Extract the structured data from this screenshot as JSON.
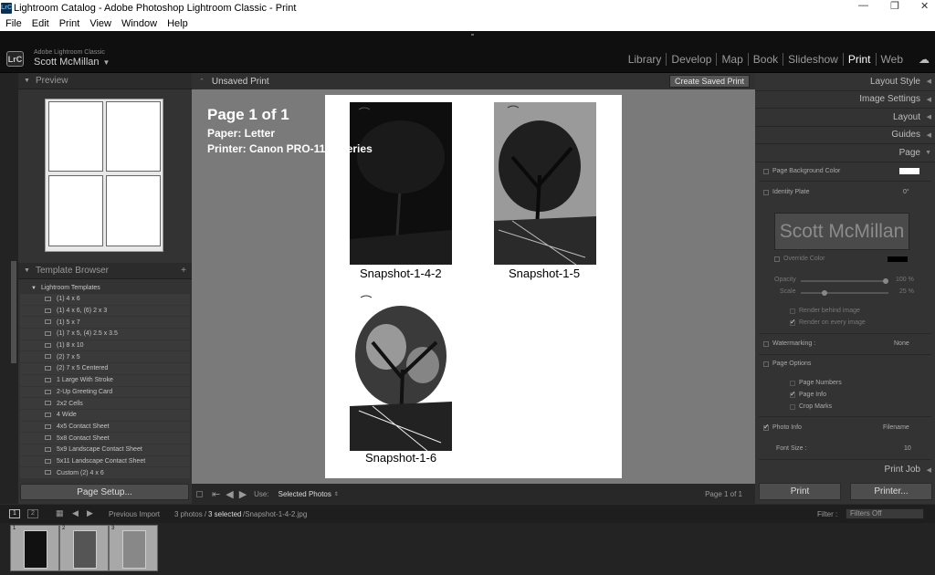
{
  "window": {
    "title": "Lightroom Catalog - Adobe Photoshop Lightroom Classic - Print",
    "app_badge": "LrC"
  },
  "menu": [
    "File",
    "Edit",
    "Print",
    "View",
    "Window",
    "Help"
  ],
  "identity": {
    "product": "Adobe Lightroom Classic",
    "user": "Scott McMillan"
  },
  "modules": [
    {
      "label": "Library"
    },
    {
      "label": "Develop"
    },
    {
      "label": "Map"
    },
    {
      "label": "Book"
    },
    {
      "label": "Slideshow"
    },
    {
      "label": "Print"
    },
    {
      "label": "Web"
    }
  ],
  "active_module": "Print",
  "left": {
    "preview_label": "Preview",
    "template_browser_label": "Template Browser",
    "template_folder": "Lightroom Templates",
    "templates": [
      "(1) 4 x 6",
      "(1) 4 x 6, (6) 2 x 3",
      "(1) 5 x 7",
      "(1) 7 x 5, (4) 2.5 x 3.5",
      "(1) 8 x 10",
      "(2) 7 x 5",
      "(2) 7 x 5 Centered",
      "1 Large With Stroke",
      "2-Up Greeting Card",
      "2x2 Cells",
      "4 Wide",
      "4x5 Contact Sheet",
      "5x8 Contact Sheet",
      "5x9 Landscape Contact Sheet",
      "5x11 Landscape Contact Sheet",
      "Custom (2) 4 x 6"
    ],
    "page_setup_label": "Page Setup..."
  },
  "center": {
    "doc_title": "Unsaved Print",
    "save_button": "Create Saved Print",
    "page_info": {
      "page": "Page 1 of 1",
      "paper": "Paper:  Letter",
      "printer": "Printer:  Canon PRO-1100 series"
    },
    "captions": [
      "Snapshot-1-4-2",
      "Snapshot-1-5",
      "Snapshot-1-6"
    ],
    "toolbar": {
      "use_label": "Use:",
      "use_value": "Selected Photos",
      "page_count": "Page 1 of 1"
    }
  },
  "right": {
    "sections": [
      "Layout Style",
      "Image Settings",
      "Layout",
      "Guides",
      "Page"
    ],
    "page_background_color": "Page Background Color",
    "identity_plate": "Identity Plate",
    "identity_plate_angle": "0°",
    "identity_plate_text": "Scott McMillan",
    "override_color": "Override Color",
    "opacity_label": "Opacity",
    "opacity_value": "100 %",
    "scale_label": "Scale",
    "scale_value": "25 %",
    "opacity_fraction": 1.0,
    "scale_fraction": 0.25,
    "render_behind": "Render behind image",
    "render_every": "Render on every image",
    "watermarking": "Watermarking :",
    "watermark_value": "None",
    "page_options": "Page Options",
    "page_numbers": "Page Numbers",
    "page_info": "Page Info",
    "crop_marks": "Crop Marks",
    "photo_info": "Photo Info",
    "photo_info_value": "Filename",
    "font_size_label": "Font Size :",
    "font_size_value": "10",
    "print_job": "Print Job",
    "print_button": "Print",
    "printer_button": "Printer..."
  },
  "filmstrip": {
    "page1": "1",
    "page2": "2",
    "source": "Previous Import",
    "status_prefix": "3 photos /",
    "status_selected": "3 selected",
    "status_file": "/Snapshot-1-4-2.jpg",
    "filter_label": "Filter :",
    "filter_value": "Filters Off",
    "thumb_numbers": [
      "1",
      "2",
      "3"
    ]
  }
}
